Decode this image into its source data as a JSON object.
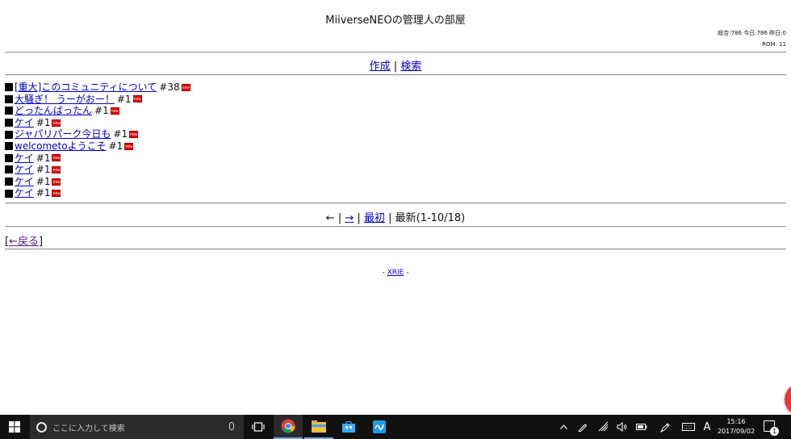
{
  "page": {
    "title": "MiiverseNEOの管理人の部屋",
    "counter_line1": "総合:786 今日:786 昨日:0",
    "counter_line2": "ROM: 11"
  },
  "nav": {
    "create": "作成",
    "search": "検索",
    "separator": "|"
  },
  "threads": [
    {
      "title": "[重大]このコミュニティについて",
      "count": "#38"
    },
    {
      "title": "大騒ぎ！ うーがおー！",
      "count": "#1"
    },
    {
      "title": "どったんばったん",
      "count": "#1"
    },
    {
      "title": "ケイ",
      "count": "#1"
    },
    {
      "title": "ジャパリパーク今日も",
      "count": "#1"
    },
    {
      "title": "welcometoようこそ",
      "count": "#1"
    },
    {
      "title": "ケイ",
      "count": "#1"
    },
    {
      "title": "ケイ",
      "count": "#1"
    },
    {
      "title": "ケイ",
      "count": "#1"
    },
    {
      "title": "ケイ",
      "count": "#1"
    }
  ],
  "new_badge": "new",
  "pager": {
    "prev": "←",
    "sep1": "|",
    "next": "→",
    "sep2": "|",
    "first": "最初",
    "sep3": "|",
    "latest": "最新(1-10/18)"
  },
  "back": {
    "open": "[",
    "label": "←戻る",
    "close": "]"
  },
  "footer": {
    "prefix": "- ",
    "link": "XRIE",
    "suffix": " -"
  },
  "taskbar": {
    "search_placeholder": "ここに入力して検索",
    "ime": "A",
    "time": "15:16",
    "date": "2017/09/02",
    "notification_count": "1"
  },
  "colors": {
    "link": "#0000cc",
    "visited": "#551a8b",
    "taskbar": "#101010",
    "fab": "#e53935"
  }
}
